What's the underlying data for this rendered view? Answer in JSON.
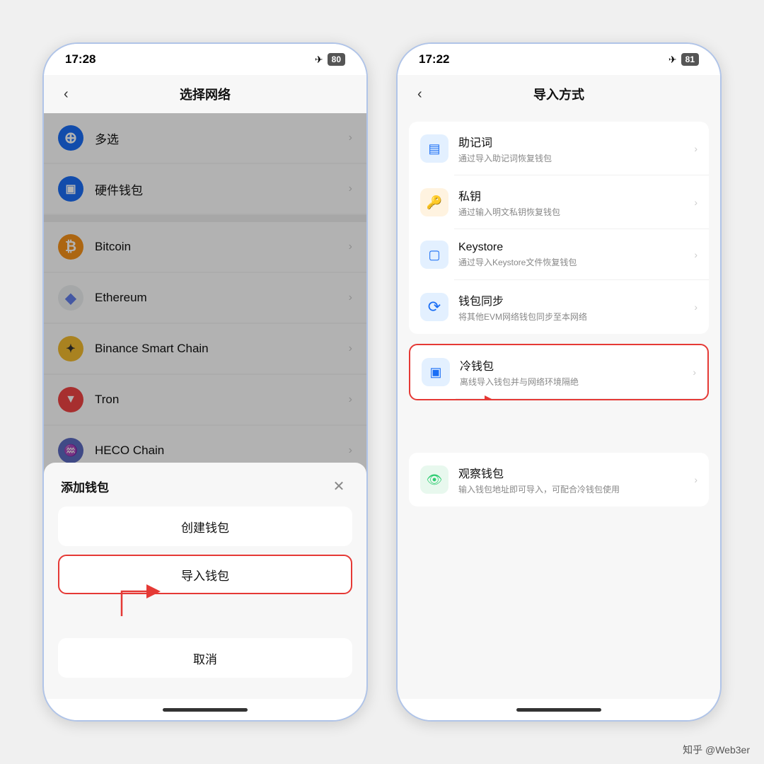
{
  "phone1": {
    "statusBar": {
      "time": "17:28",
      "battery": "80"
    },
    "navTitle": "选择网络",
    "backLabel": "‹",
    "networks": [
      {
        "id": "multi",
        "label": "多选",
        "iconBg": "#1a6ef5",
        "iconText": "⊕",
        "iconColor": "#fff"
      },
      {
        "id": "hardware",
        "label": "硬件钱包",
        "iconBg": "#1a6ef5",
        "iconText": "▣",
        "iconColor": "#fff"
      },
      {
        "id": "bitcoin",
        "label": "Bitcoin",
        "iconBg": "#f7931a",
        "iconText": "₿",
        "iconColor": "#fff"
      },
      {
        "id": "ethereum",
        "label": "Ethereum",
        "iconBg": "#eceff1",
        "iconText": "♦",
        "iconColor": "#627eea"
      },
      {
        "id": "binance",
        "label": "Binance Smart Chain",
        "iconBg": "#f3ba2f",
        "iconText": "✦",
        "iconColor": "#333"
      },
      {
        "id": "tron",
        "label": "Tron",
        "iconBg": "#ef4444",
        "iconText": "▼",
        "iconColor": "#fff"
      },
      {
        "id": "heco",
        "label": "HECO Chain",
        "iconBg": "#5c6bc0",
        "iconText": "♒",
        "iconColor": "#fff"
      }
    ],
    "modal": {
      "title": "添加钱包",
      "createLabel": "创建钱包",
      "importLabel": "导入钱包",
      "cancelLabel": "取消"
    }
  },
  "phone2": {
    "statusBar": {
      "time": "17:22",
      "battery": "81"
    },
    "navTitle": "导入方式",
    "backLabel": "‹",
    "section1": [
      {
        "id": "mnemonic",
        "title": "助记词",
        "sub": "通过导入助记词恢复钱包",
        "iconBg": "#e3f0ff",
        "iconText": "▤",
        "iconColor": "#1a6ef5"
      },
      {
        "id": "privatekey",
        "title": "私钥",
        "sub": "通过输入明文私钥恢复钱包",
        "iconBg": "#fff0e0",
        "iconText": "🔑",
        "iconColor": "#f7931a"
      },
      {
        "id": "keystore",
        "title": "Keystore",
        "sub": "通过导入Keystore文件恢复钱包",
        "iconBg": "#e3f0ff",
        "iconText": "▢",
        "iconColor": "#1a6ef5"
      },
      {
        "id": "walletsync",
        "title": "钱包同步",
        "sub": "将其他EVM网络钱包同步至本网络",
        "iconBg": "#e3f0ff",
        "iconText": "⟳",
        "iconColor": "#1a6ef5"
      }
    ],
    "section2": [
      {
        "id": "coldwallet",
        "title": "冷钱包",
        "sub": "离线导入钱包并与网络环境隔绝",
        "iconBg": "#e3f0ff",
        "iconText": "▣",
        "iconColor": "#1a6ef5",
        "highlighted": true
      }
    ],
    "section3": [
      {
        "id": "watchonly",
        "title": "观察钱包",
        "sub": "输入钱包地址即可导入，可配合冷钱包使用",
        "iconBg": "#e8f8ee",
        "iconText": "👁",
        "iconColor": "#2ecc71"
      }
    ]
  },
  "watermark": "知乎 @Web3er"
}
